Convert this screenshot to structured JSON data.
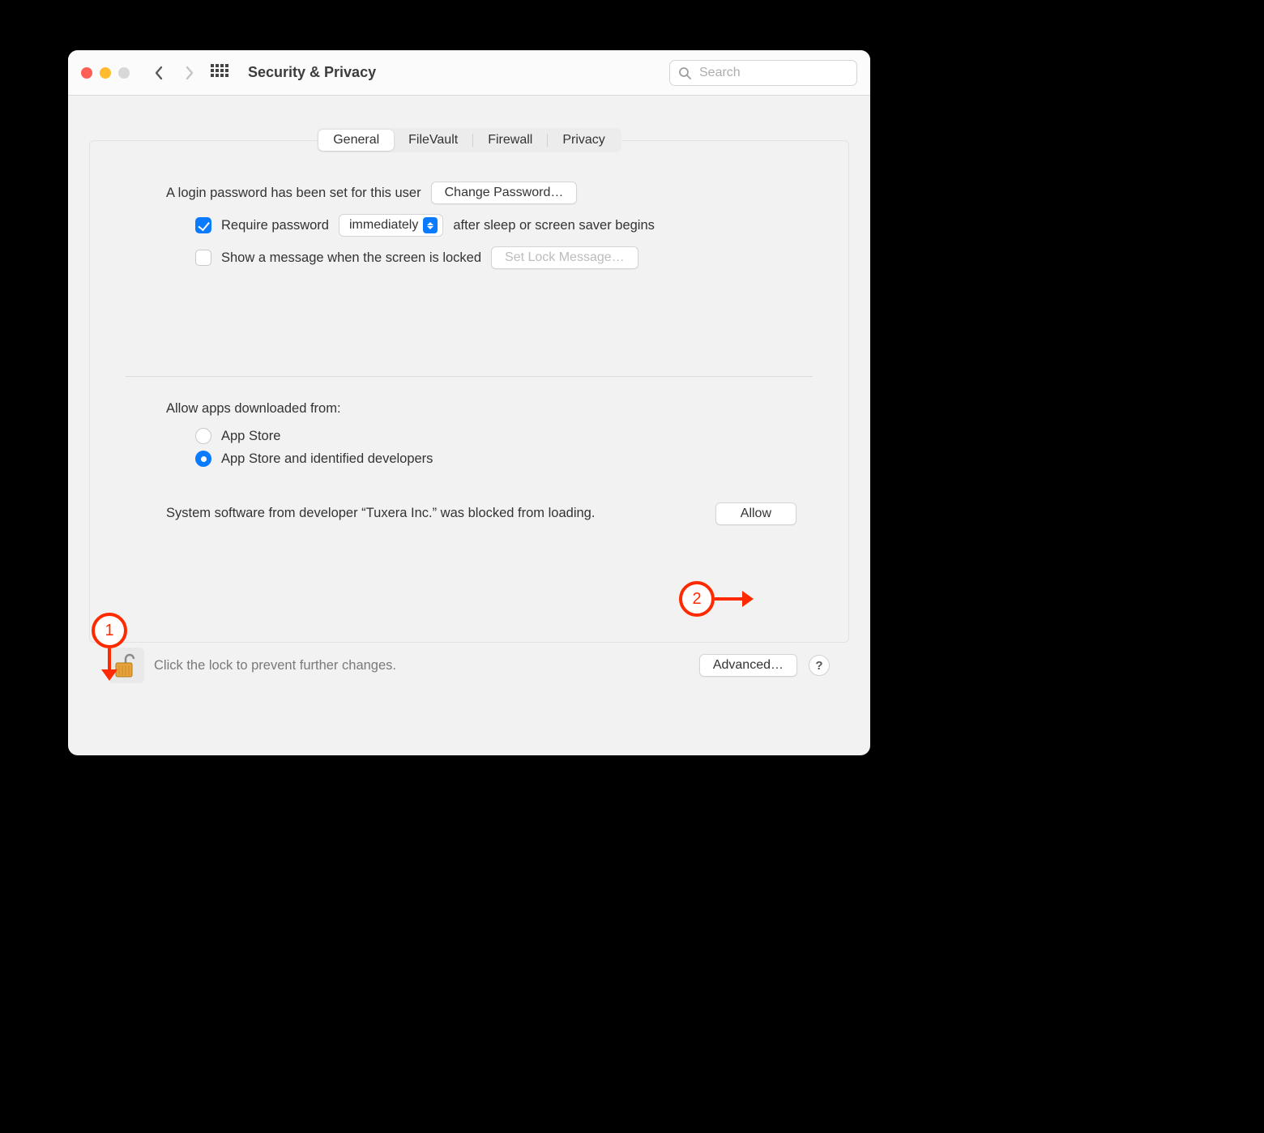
{
  "window": {
    "title": "Security & Privacy"
  },
  "search": {
    "placeholder": "Search"
  },
  "tabs": {
    "general": "General",
    "filevault": "FileVault",
    "firewall": "Firewall",
    "privacy": "Privacy"
  },
  "login": {
    "password_set_text": "A login password has been set for this user",
    "change_password_btn": "Change Password…",
    "require_password_label": "Require password",
    "delay_select_value": "immediately",
    "after_sleep_text": "after sleep or screen saver begins",
    "show_message_label": "Show a message when the screen is locked",
    "set_lock_message_btn": "Set Lock Message…"
  },
  "gatekeeper": {
    "heading": "Allow apps downloaded from:",
    "option_app_store": "App Store",
    "option_identified": "App Store and identified developers",
    "blocked_text": "System software from developer “Tuxera Inc.” was blocked from loading.",
    "allow_btn": "Allow"
  },
  "footer": {
    "lock_text": "Click the lock to prevent further changes.",
    "advanced_btn": "Advanced…",
    "help": "?"
  },
  "annotations": {
    "one": "1",
    "two": "2"
  }
}
